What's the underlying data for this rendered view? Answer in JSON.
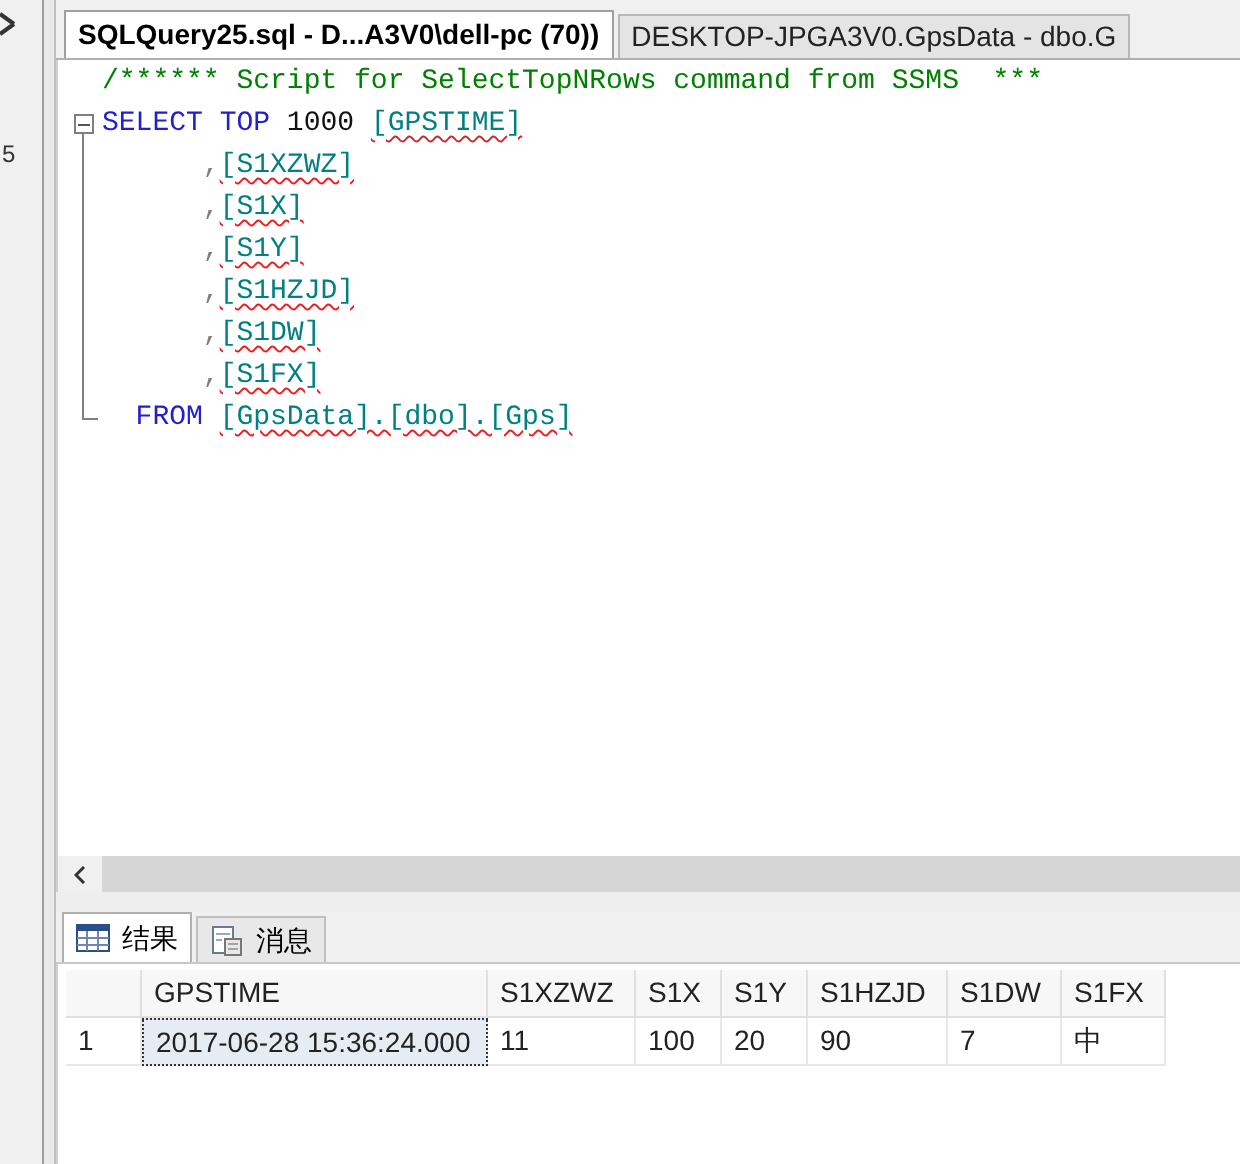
{
  "left_panel": {
    "text": "5"
  },
  "tabs": [
    {
      "label": "SQLQuery25.sql - D...A3V0\\dell-pc (70))",
      "selected": true
    },
    {
      "label": "DESKTOP-JPGA3V0.GpsData - dbo.G",
      "selected": false
    }
  ],
  "editor": {
    "lines": [
      {
        "kind": "plain",
        "tokens": [
          {
            "kind": "comment",
            "text": "/****** Script for SelectTopNRows command from SSMS  ***"
          }
        ]
      },
      {
        "kind": "fold-start",
        "tokens": [
          {
            "kind": "keyword",
            "text": "SELECT"
          },
          {
            "kind": "keyword",
            "text": " TOP"
          },
          {
            "kind": "plain",
            "text": " 1000 "
          },
          {
            "kind": "identifier",
            "text": "[GPSTIME]"
          }
        ]
      },
      {
        "kind": "fold-body",
        "tokens": [
          {
            "kind": "punct",
            "text": "      ,"
          },
          {
            "kind": "identifier",
            "text": "[S1XZWZ]"
          }
        ]
      },
      {
        "kind": "fold-body",
        "tokens": [
          {
            "kind": "punct",
            "text": "      ,"
          },
          {
            "kind": "identifier",
            "text": "[S1X]"
          }
        ]
      },
      {
        "kind": "fold-body",
        "tokens": [
          {
            "kind": "punct",
            "text": "      ,"
          },
          {
            "kind": "identifier",
            "text": "[S1Y]"
          }
        ]
      },
      {
        "kind": "fold-body",
        "tokens": [
          {
            "kind": "punct",
            "text": "      ,"
          },
          {
            "kind": "identifier",
            "text": "[S1HZJD]"
          }
        ]
      },
      {
        "kind": "fold-body",
        "tokens": [
          {
            "kind": "punct",
            "text": "      ,"
          },
          {
            "kind": "identifier",
            "text": "[S1DW]"
          }
        ]
      },
      {
        "kind": "fold-body",
        "tokens": [
          {
            "kind": "punct",
            "text": "      ,"
          },
          {
            "kind": "identifier",
            "text": "[S1FX]"
          }
        ]
      },
      {
        "kind": "fold-end",
        "tokens": [
          {
            "kind": "keyword",
            "text": "  FROM "
          },
          {
            "kind": "identifier",
            "text": "[GpsData].[dbo].[Gps]"
          }
        ]
      }
    ]
  },
  "result_tabs": [
    {
      "label": "结果",
      "kind": "grid",
      "selected": true
    },
    {
      "label": "消息",
      "kind": "messages",
      "selected": false
    }
  ],
  "results": {
    "columns": [
      "GPSTIME",
      "S1XZWZ",
      "S1X",
      "S1Y",
      "S1HZJD",
      "S1DW",
      "S1FX"
    ],
    "rows": [
      {
        "number": "1",
        "cells": [
          {
            "text": "2017-06-28 15:36:24.000",
            "selected": true
          },
          {
            "text": "11",
            "selected": false
          },
          {
            "text": "100",
            "selected": false
          },
          {
            "text": "20",
            "selected": false
          },
          {
            "text": "90",
            "selected": false
          },
          {
            "text": "7",
            "selected": false
          },
          {
            "text": "中",
            "selected": false
          }
        ]
      }
    ]
  }
}
